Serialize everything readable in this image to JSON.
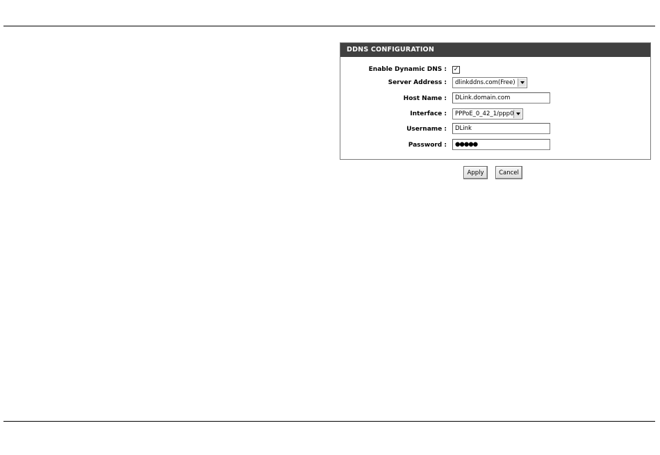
{
  "ddns": {
    "header": "DDNS CONFIGURATION",
    "enable": {
      "label": "Enable Dynamic DNS :",
      "checked": true
    },
    "server": {
      "label": "Server Address :",
      "value": "dlinkddns.com(Free)"
    },
    "host": {
      "label": "Host Name :",
      "value": "DLink.domain.com"
    },
    "interface": {
      "label": "Interface :",
      "value": "PPPoE_0_42_1/ppp0"
    },
    "username": {
      "label": "Username :",
      "value": "DLink"
    },
    "password": {
      "label": "Password :",
      "value": "●●●●●"
    }
  },
  "buttons": {
    "apply": "Apply",
    "cancel": "Cancel"
  }
}
